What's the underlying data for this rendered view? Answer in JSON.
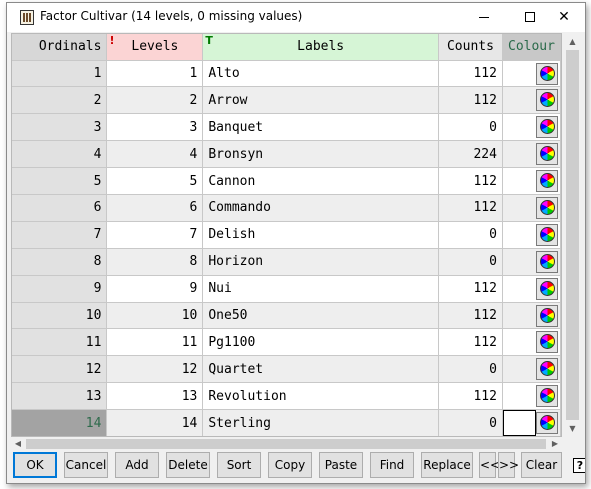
{
  "window": {
    "title": "Factor Cultivar (14 levels, 0 missing values)",
    "controls": {
      "close_glyph": "✕"
    }
  },
  "grid": {
    "headers": {
      "ordinals": "Ordinals",
      "levels": "Levels",
      "labels": "Labels",
      "counts": "Counts",
      "colour": "Colour",
      "levels_marker": "!",
      "labels_marker": "T"
    },
    "rows": [
      {
        "ordinal": "1",
        "level": "1",
        "label": "Alto",
        "count": "112"
      },
      {
        "ordinal": "2",
        "level": "2",
        "label": "Arrow",
        "count": "112"
      },
      {
        "ordinal": "3",
        "level": "3",
        "label": "Banquet",
        "count": "0"
      },
      {
        "ordinal": "4",
        "level": "4",
        "label": "Bronsyn",
        "count": "224"
      },
      {
        "ordinal": "5",
        "level": "5",
        "label": "Cannon",
        "count": "112"
      },
      {
        "ordinal": "6",
        "level": "6",
        "label": "Commando",
        "count": "112"
      },
      {
        "ordinal": "7",
        "level": "7",
        "label": "Delish",
        "count": "0"
      },
      {
        "ordinal": "8",
        "level": "8",
        "label": "Horizon",
        "count": "0"
      },
      {
        "ordinal": "9",
        "level": "9",
        "label": "Nui",
        "count": "112"
      },
      {
        "ordinal": "10",
        "level": "10",
        "label": "One50",
        "count": "112"
      },
      {
        "ordinal": "11",
        "level": "11",
        "label": "Pg1100",
        "count": "112"
      },
      {
        "ordinal": "12",
        "level": "12",
        "label": "Quartet",
        "count": "0"
      },
      {
        "ordinal": "13",
        "level": "13",
        "label": "Revolution",
        "count": "112"
      },
      {
        "ordinal": "14",
        "level": "14",
        "label": "Sterling",
        "count": "0"
      }
    ],
    "selected_row": 14
  },
  "scrollbars": {
    "up_glyph": "▲",
    "down_glyph": "▼",
    "left_glyph": "◀",
    "right_glyph": "▶"
  },
  "buttons": {
    "ok": "OK",
    "cancel": "Cancel",
    "add": "Add",
    "delete": "Delete",
    "sort": "Sort",
    "copy": "Copy",
    "paste": "Paste",
    "find": "Find",
    "replace": "Replace",
    "prev": "<<",
    "next": ">>",
    "clear": "Clear",
    "help": "?"
  },
  "colors": {
    "levels_header": "#fbd4d4",
    "labels_header": "#d6f5d6",
    "colour_header_text": "#2a6a4a",
    "default_button_border": "#0078d7"
  },
  "icons": {
    "app": "factor-window-icon",
    "colour_swatch": "colour-wheel-icon"
  }
}
